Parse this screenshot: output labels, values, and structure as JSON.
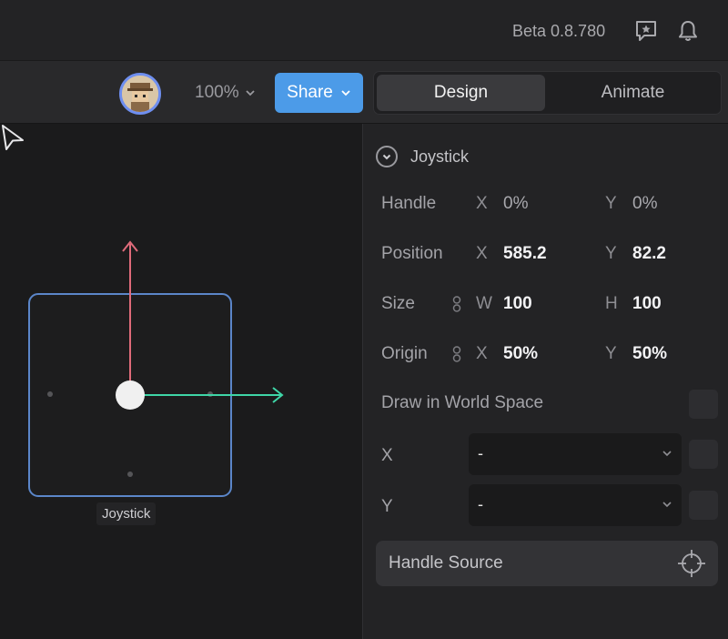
{
  "header": {
    "version": "Beta 0.8.780",
    "icons": {
      "feedback": "chat-star-icon",
      "notifications": "bell-icon"
    }
  },
  "toolbar": {
    "avatar_icon": "user-avatar",
    "zoom": "100%",
    "share_label": "Share",
    "tabs": [
      {
        "label": "Design",
        "active": true
      },
      {
        "label": "Animate",
        "active": false
      }
    ]
  },
  "canvas": {
    "object_label": "Joystick",
    "colors": {
      "selection": "#5b86c9",
      "y_axis": "#e06b7a",
      "x_axis": "#3fd6a7",
      "handle": "#f0f0f0"
    }
  },
  "panel": {
    "section_title": "Joystick",
    "handle": {
      "label": "Handle",
      "x_axis": "X",
      "x": "0%",
      "y_axis": "Y",
      "y": "0%"
    },
    "position": {
      "label": "Position",
      "x_axis": "X",
      "x": "585.2",
      "y_axis": "Y",
      "y": "82.2"
    },
    "size": {
      "label": "Size",
      "w_axis": "W",
      "w": "100",
      "h_axis": "H",
      "h": "100"
    },
    "origin": {
      "label": "Origin",
      "x_axis": "X",
      "x": "50%",
      "y_axis": "Y",
      "y": "50%"
    },
    "world_space_label": "Draw in World Space",
    "x_select": {
      "label": "X",
      "value": "-"
    },
    "y_select": {
      "label": "Y",
      "value": "-"
    },
    "handle_source_label": "Handle Source"
  }
}
